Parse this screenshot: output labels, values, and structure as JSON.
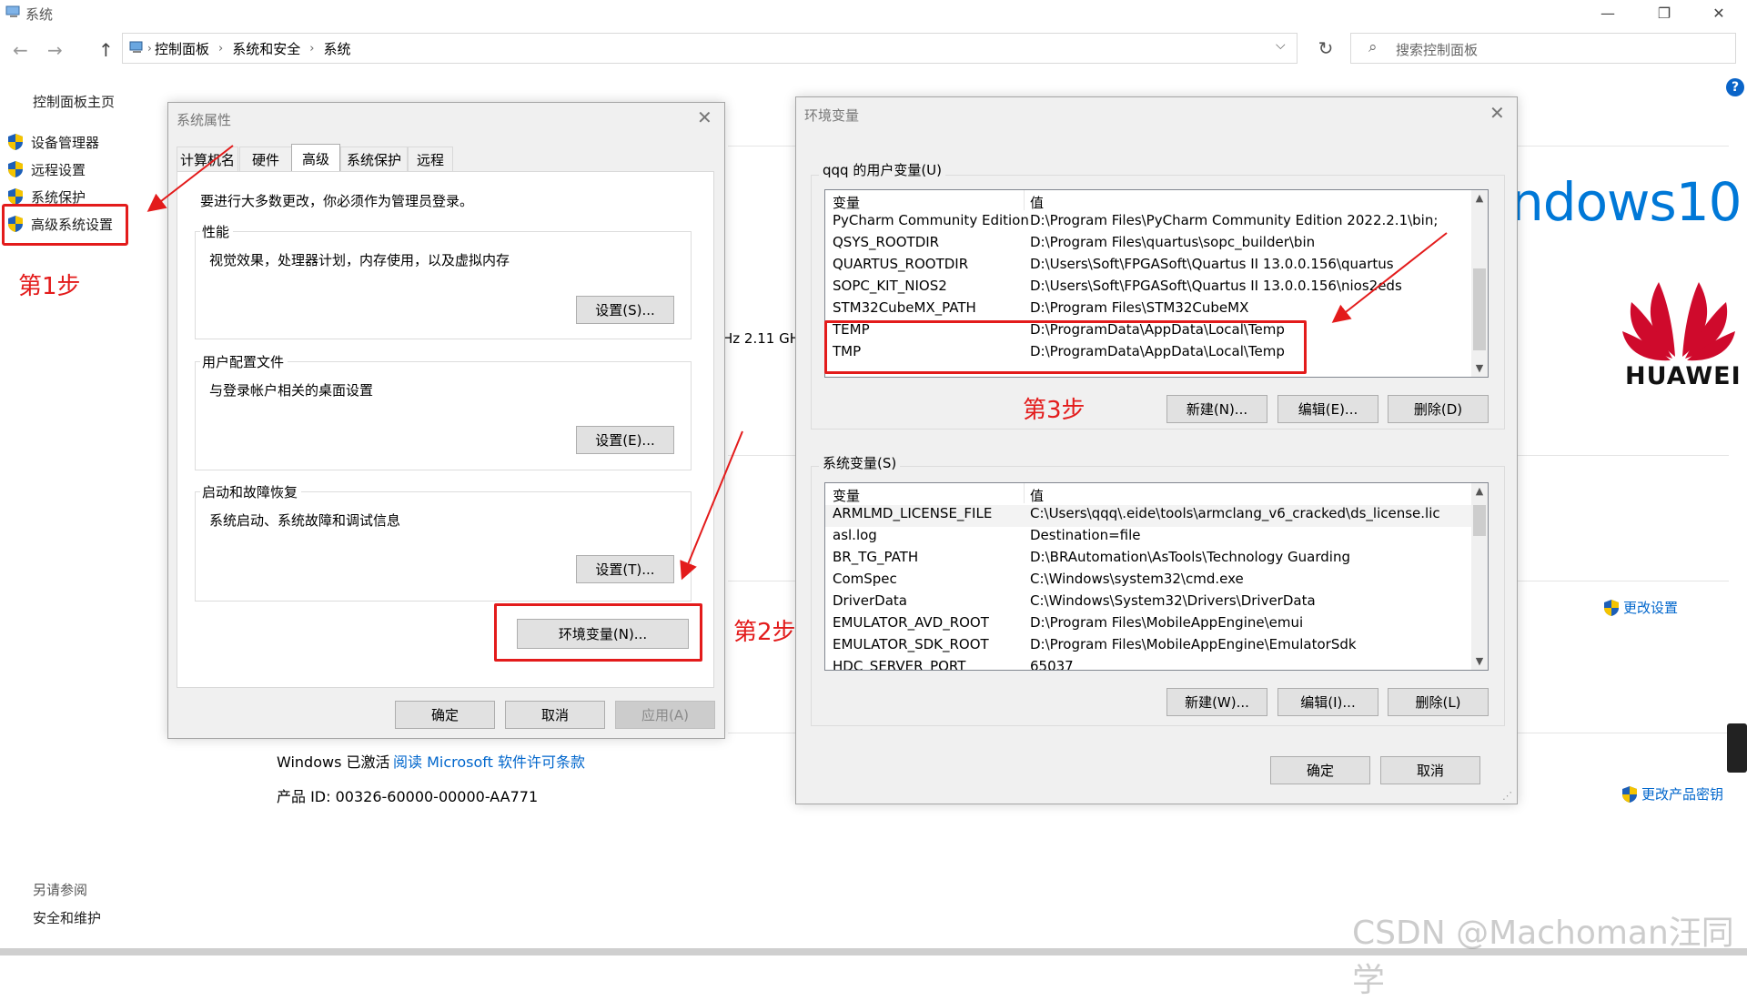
{
  "window": {
    "title": "系统",
    "minimize": "—",
    "maximize": "❐",
    "close": "✕"
  },
  "nav": {
    "back": "←",
    "forward": "→",
    "up": "↑",
    "breadcrumbs": [
      "控制面板",
      "系统和安全",
      "系统"
    ],
    "search_placeholder": "搜索控制面板"
  },
  "sidebar": {
    "home": "控制面板主页",
    "items": [
      {
        "label": "设备管理器"
      },
      {
        "label": "远程设置"
      },
      {
        "label": "系统保护"
      },
      {
        "label": "高级系统设置"
      }
    ],
    "see_also_title": "另请参阅",
    "see_also_link": "安全和维护"
  },
  "annotations": {
    "step1": "第1步",
    "step2": "第2步",
    "step3": "第3步"
  },
  "background": {
    "windows_logo_text": "ndows10",
    "brand": "HUAWEI",
    "cpu_partial": "Hz   2.11 GH",
    "change_settings": "更改设置",
    "activated": "Windows 已激活",
    "license_link": "阅读 Microsoft 软件许可条款",
    "product_id": "产品 ID: 00326-60000-00000-AA771",
    "change_key": "更改产品密钥",
    "watermark": "CSDN @Machoman汪同学"
  },
  "sysprops": {
    "title": "系统属性",
    "tabs": [
      "计算机名",
      "硬件",
      "高级",
      "系统保护",
      "远程"
    ],
    "admin_note": "要进行大多数更改，你必须作为管理员登录。",
    "groups": [
      {
        "label": "性能",
        "desc": "视觉效果，处理器计划，内存使用，以及虚拟内存",
        "button": "设置(S)..."
      },
      {
        "label": "用户配置文件",
        "desc": "与登录帐户相关的桌面设置",
        "button": "设置(E)..."
      },
      {
        "label": "启动和故障恢复",
        "desc": "系统启动、系统故障和调试信息",
        "button": "设置(T)..."
      }
    ],
    "env_button": "环境变量(N)...",
    "ok": "确定",
    "cancel": "取消",
    "apply": "应用(A)"
  },
  "envvars": {
    "title": "环境变量",
    "user_group_label": "qqq 的用户变量(U)",
    "col_var": "变量",
    "col_val": "值",
    "user_rows": [
      {
        "name": "PyCharm Community Edition",
        "value": "D:\\Program Files\\PyCharm Community Edition 2022.2.1\\bin;"
      },
      {
        "name": "QSYS_ROOTDIR",
        "value": "D:\\Program Files\\quartus\\sopc_builder\\bin"
      },
      {
        "name": "QUARTUS_ROOTDIR",
        "value": "D:\\Users\\Soft\\FPGASoft\\Quartus II 13.0.0.156\\quartus"
      },
      {
        "name": "SOPC_KIT_NIOS2",
        "value": "D:\\Users\\Soft\\FPGASoft\\Quartus II 13.0.0.156\\nios2eds"
      },
      {
        "name": "STM32CubeMX_PATH",
        "value": "D:\\Program Files\\STM32CubeMX"
      },
      {
        "name": "TEMP",
        "value": "D:\\ProgramData\\AppData\\Local\\Temp"
      },
      {
        "name": "TMP",
        "value": "D:\\ProgramData\\AppData\\Local\\Temp"
      }
    ],
    "user_new": "新建(N)...",
    "user_edit": "编辑(E)...",
    "user_delete": "删除(D)",
    "sys_group_label": "系统变量(S)",
    "sys_rows": [
      {
        "name": "ARMLMD_LICENSE_FILE",
        "value": "C:\\Users\\qqq\\.eide\\tools\\armclang_v6_cracked\\ds_license.lic"
      },
      {
        "name": "asl.log",
        "value": "Destination=file"
      },
      {
        "name": "BR_TG_PATH",
        "value": "D:\\BRAutomation\\AsTools\\Technology Guarding"
      },
      {
        "name": "ComSpec",
        "value": "C:\\Windows\\system32\\cmd.exe"
      },
      {
        "name": "DriverData",
        "value": "C:\\Windows\\System32\\Drivers\\DriverData"
      },
      {
        "name": "EMULATOR_AVD_ROOT",
        "value": "D:\\Program Files\\MobileAppEngine\\emui"
      },
      {
        "name": "EMULATOR_SDK_ROOT",
        "value": "D:\\Program Files\\MobileAppEngine\\EmulatorSdk"
      },
      {
        "name": "HDC_SERVER_PORT",
        "value": "65037"
      }
    ],
    "sys_new": "新建(W)...",
    "sys_edit": "编辑(I)...",
    "sys_delete": "删除(L)",
    "ok": "确定",
    "cancel": "取消"
  },
  "colors": {
    "accent_red": "#e31b1b",
    "link_blue": "#0066cc",
    "win_blue": "#0078d7",
    "huawei_red": "#cf0a2c"
  }
}
